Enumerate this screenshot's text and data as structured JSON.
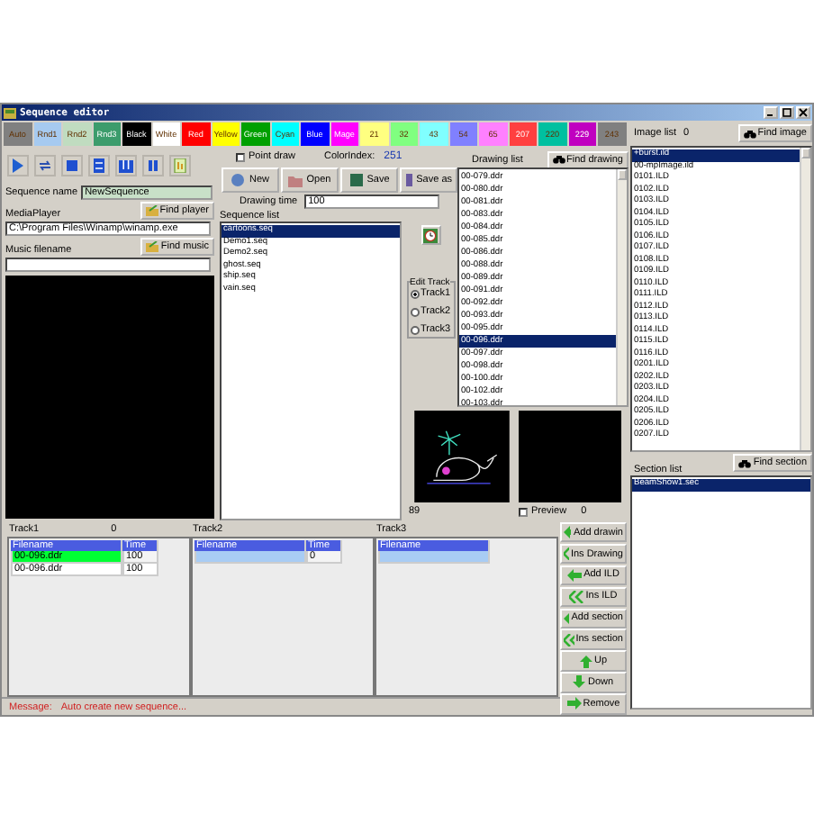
{
  "window": {
    "title": "Sequence editor"
  },
  "color_bar": [
    {
      "label": "Auto",
      "color": "#808080"
    },
    {
      "label": "Rnd1",
      "color": "#a6caf0"
    },
    {
      "label": "Rnd2",
      "color": "#c0dcc0"
    },
    {
      "label": "Rnd3",
      "color": "#3c9c6c"
    },
    {
      "label": "Black",
      "color": "#000000"
    },
    {
      "label": "White",
      "color": "#ffffff"
    },
    {
      "label": "Red",
      "color": "#ff0000"
    },
    {
      "label": "Yellow",
      "color": "#ffff00"
    },
    {
      "label": "Green",
      "color": "#00a000"
    },
    {
      "label": "Cyan",
      "color": "#00ffff"
    },
    {
      "label": "Blue",
      "color": "#0000ff"
    },
    {
      "label": "Mage",
      "color": "#ff00ff"
    },
    {
      "label": "21",
      "color": "#ffff80"
    },
    {
      "label": "32",
      "color": "#80ff80"
    },
    {
      "label": "43",
      "color": "#80ffff"
    },
    {
      "label": "54",
      "color": "#8080ff"
    },
    {
      "label": "65",
      "color": "#ff80ff"
    },
    {
      "label": "207",
      "color": "#ff4040"
    },
    {
      "label": "220",
      "color": "#00c0a0"
    },
    {
      "label": "229",
      "color": "#c000c0"
    },
    {
      "label": "243",
      "color": "#808080"
    }
  ],
  "point_draw": {
    "label": "Point draw",
    "checked": false
  },
  "color_index": {
    "label": "ColorIndex:",
    "value": "251"
  },
  "file_buttons": [
    {
      "label": "New",
      "kind": "new"
    },
    {
      "label": "Open",
      "kind": "open"
    },
    {
      "label": "Save",
      "kind": "save"
    },
    {
      "label": "Save as",
      "kind": "saveas"
    }
  ],
  "sequence_name": {
    "label": "Sequence name",
    "value": "NewSequence"
  },
  "media_player": {
    "label": "MediaPlayer",
    "button": "Find player",
    "value": "C:\\Program Files\\Winamp\\winamp.exe"
  },
  "music": {
    "label": "Music filename",
    "button": "Find music"
  },
  "drawing_time": {
    "label": "Drawing time",
    "value": "100"
  },
  "sequence_list": {
    "label": "Sequence list",
    "items": [
      {
        "text": "cartoons.seq",
        "selected": true
      },
      {
        "text": "Demo1.seq",
        "selected": false
      },
      {
        "text": "Demo2.seq",
        "selected": false
      },
      {
        "text": "ghost.seq",
        "selected": false
      },
      {
        "text": "ship.seq",
        "selected": false
      },
      {
        "text": "vain.seq",
        "selected": false
      }
    ]
  },
  "edit_track": {
    "label": "Edit Track",
    "options": [
      {
        "label": "Track1",
        "selected": true
      },
      {
        "label": "Track2",
        "selected": false
      },
      {
        "label": "Track3",
        "selected": false
      }
    ]
  },
  "drawing_list": {
    "label": "Drawing list",
    "button": "Find drawing",
    "items": [
      {
        "text": "00-079.ddr",
        "selected": false
      },
      {
        "text": "00-080.ddr",
        "selected": false
      },
      {
        "text": "00-081.ddr",
        "selected": false
      },
      {
        "text": "00-083.ddr",
        "selected": false
      },
      {
        "text": "00-084.ddr",
        "selected": false
      },
      {
        "text": "00-085.ddr",
        "selected": false
      },
      {
        "text": "00-086.ddr",
        "selected": false
      },
      {
        "text": "00-088.ddr",
        "selected": false
      },
      {
        "text": "00-089.ddr",
        "selected": false
      },
      {
        "text": "00-091.ddr",
        "selected": false
      },
      {
        "text": "00-092.ddr",
        "selected": false
      },
      {
        "text": "00-093.ddr",
        "selected": false
      },
      {
        "text": "00-095.ddr",
        "selected": false
      },
      {
        "text": "00-096.ddr",
        "selected": true
      },
      {
        "text": "00-097.ddr",
        "selected": false
      },
      {
        "text": "00-098.ddr",
        "selected": false
      },
      {
        "text": "00-100.ddr",
        "selected": false
      },
      {
        "text": "00-102.ddr",
        "selected": false
      },
      {
        "text": "00-103.ddr",
        "selected": false
      }
    ]
  },
  "previews": {
    "count": "89",
    "preview": {
      "label": "Preview",
      "checked": false
    },
    "preview_count": "0"
  },
  "image_list": {
    "label": "Image list",
    "count": "0",
    "button": "Find image",
    "items": [
      {
        "text": "+burst.ild",
        "selected": true
      },
      {
        "text": "00-mpImage.ild",
        "selected": false
      },
      {
        "text": "0101.ILD",
        "selected": false
      },
      {
        "text": "0102.ILD",
        "selected": false
      },
      {
        "text": "0103.ILD",
        "selected": false
      },
      {
        "text": "0104.ILD",
        "selected": false
      },
      {
        "text": "0105.ILD",
        "selected": false
      },
      {
        "text": "0106.ILD",
        "selected": false
      },
      {
        "text": "0107.ILD",
        "selected": false
      },
      {
        "text": "0108.ILD",
        "selected": false
      },
      {
        "text": "0109.ILD",
        "selected": false
      },
      {
        "text": "0110.ILD",
        "selected": false
      },
      {
        "text": "0111.ILD",
        "selected": false
      },
      {
        "text": "0112.ILD",
        "selected": false
      },
      {
        "text": "0113.ILD",
        "selected": false
      },
      {
        "text": "0114.ILD",
        "selected": false
      },
      {
        "text": "0115.ILD",
        "selected": false
      },
      {
        "text": "0116.ILD",
        "selected": false
      },
      {
        "text": "0201.ILD",
        "selected": false
      },
      {
        "text": "0202.ILD",
        "selected": false
      },
      {
        "text": "0203.ILD",
        "selected": false
      },
      {
        "text": "0204.ILD",
        "selected": false
      },
      {
        "text": "0205.ILD",
        "selected": false
      },
      {
        "text": "0206.ILD",
        "selected": false
      },
      {
        "text": "0207.ILD",
        "selected": false
      }
    ]
  },
  "section_list": {
    "label": "Section list",
    "button": "Find section",
    "items": [
      {
        "text": "BeamShow1.sec",
        "selected": true
      }
    ]
  },
  "tracks": [
    {
      "label": "Track1",
      "count": "0",
      "columns": [
        {
          "kind": "filename",
          "label": "Filename"
        },
        {
          "kind": "time",
          "label": "Time"
        }
      ],
      "rows": [
        {
          "filename": "00-096.ddr",
          "time": "100",
          "selected": true
        },
        {
          "filename": "00-096.ddr",
          "time": "100",
          "selected": false
        }
      ]
    },
    {
      "label": "Track2",
      "columns": [
        {
          "kind": "filename",
          "label": "Filename"
        },
        {
          "kind": "time",
          "label": "Time"
        }
      ],
      "rows": [
        {
          "time": "0",
          "selected": true
        }
      ]
    },
    {
      "label": "Track3",
      "columns": [
        {
          "kind": "filename",
          "label": "Filename"
        }
      ],
      "rows": [
        {
          "selected": true
        }
      ]
    }
  ],
  "action_buttons": [
    {
      "label": "Add drawin",
      "kind": "add"
    },
    {
      "label": "Ins Drawing",
      "kind": "insert"
    },
    {
      "label": "Add ILD",
      "kind": "add"
    },
    {
      "label": "Ins ILD",
      "kind": "insert"
    },
    {
      "label": "Add section",
      "kind": "add"
    },
    {
      "label": "Ins section",
      "kind": "insert"
    },
    {
      "label": "Up",
      "kind": "up"
    },
    {
      "label": "Down",
      "kind": "down"
    },
    {
      "label": "Remove",
      "kind": "remove"
    }
  ],
  "message": {
    "label": "Message:",
    "text": "Auto create new sequence..."
  }
}
